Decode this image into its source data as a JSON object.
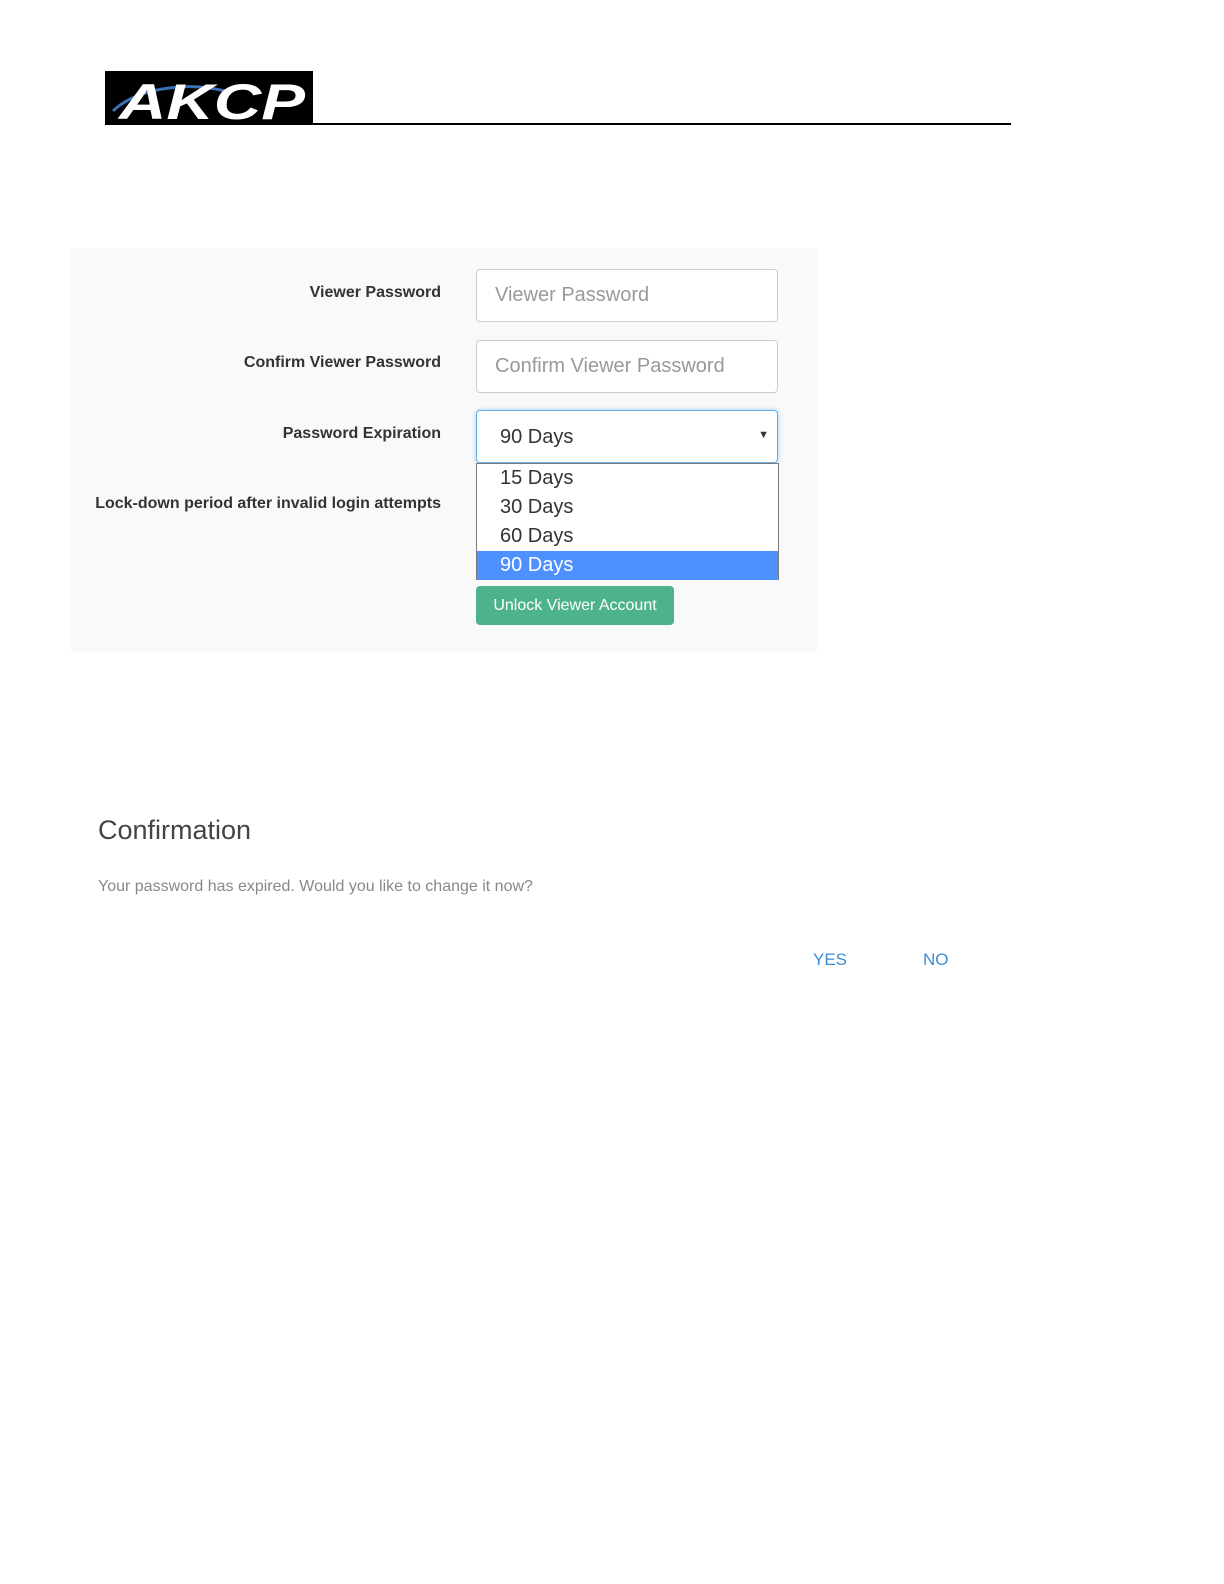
{
  "header": {
    "logo_text": "AKCP"
  },
  "settings": {
    "viewer_password": {
      "label": "Viewer Password",
      "placeholder": "Viewer Password",
      "value": ""
    },
    "confirm_viewer_password": {
      "label": "Confirm Viewer Password",
      "placeholder": "Confirm Viewer Password",
      "value": ""
    },
    "password_expiration": {
      "label": "Password Expiration",
      "selected": "90 Days",
      "options": [
        "15 Days",
        "30 Days",
        "60 Days",
        "90 Days"
      ],
      "dropdown_open": true
    },
    "lockdown": {
      "label": "Lock-down period after invalid login attempts"
    },
    "unlock_button_label": "Unlock Viewer Account"
  },
  "confirmation": {
    "title": "Confirmation",
    "message": "Your password has expired. Would you like to change it now?",
    "yes_label": "YES",
    "no_label": "NO"
  },
  "colors": {
    "panel_bg": "#f9f9f9",
    "selected_option": "#4d90fe",
    "unlock_button": "#4db38a",
    "dialog_action": "#3b8fd4",
    "logo_bg": "#000000"
  }
}
